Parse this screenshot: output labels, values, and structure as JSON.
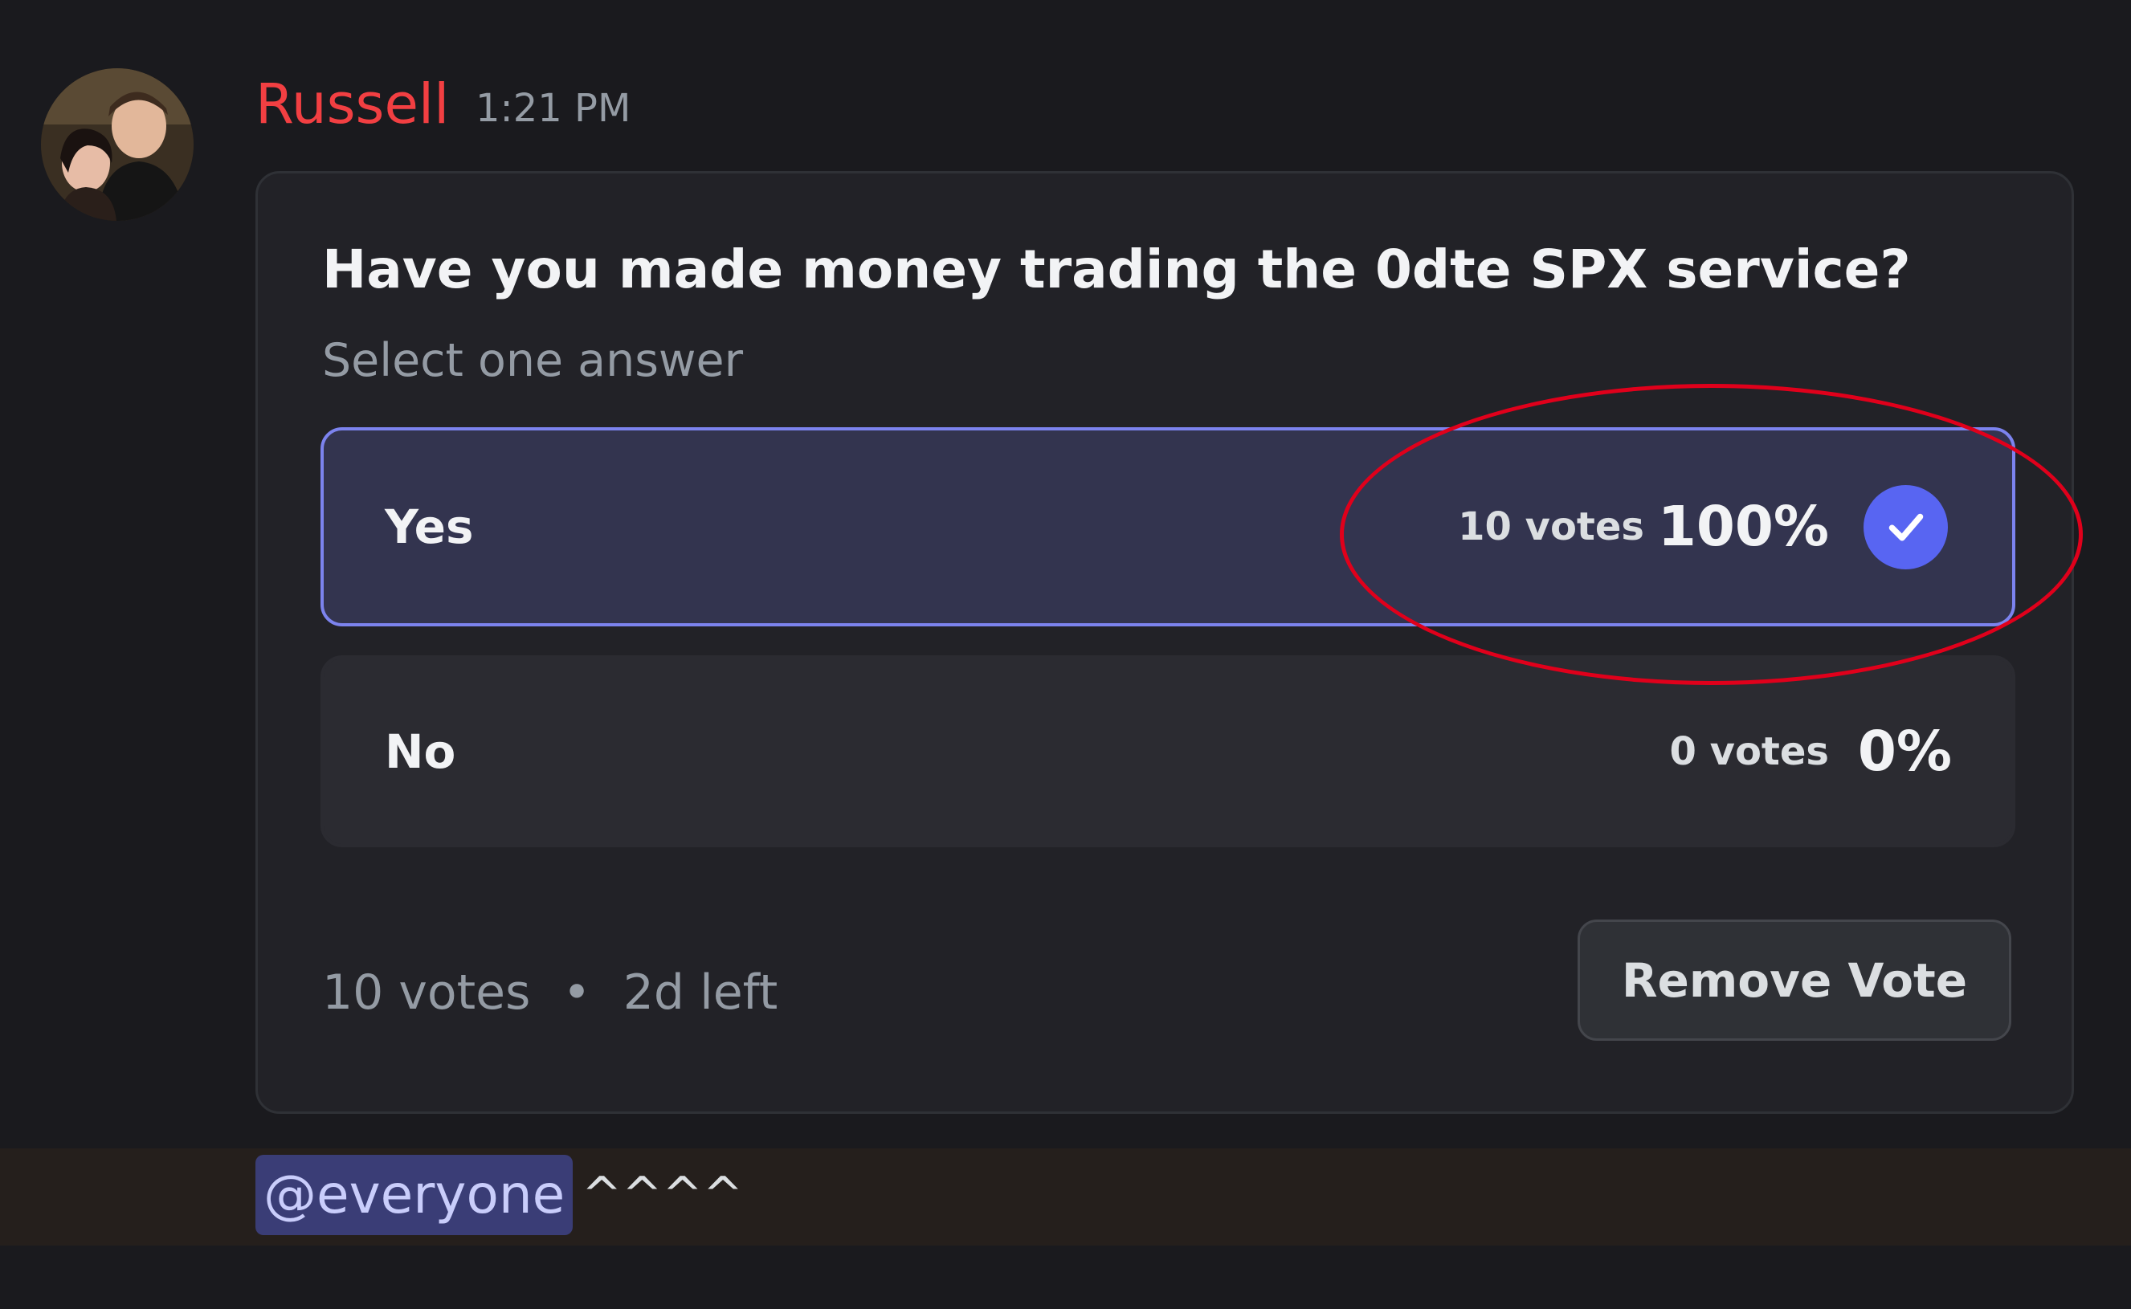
{
  "message": {
    "author": "Russell",
    "author_color": "#f23f42",
    "timestamp": "1:21 PM"
  },
  "poll": {
    "question": "Have you made money trading the 0dte SPX service?",
    "hint": "Select one answer",
    "answers": [
      {
        "label": "Yes",
        "votes": "10 votes",
        "percent": "100%",
        "fraction": 1.0,
        "selected": true,
        "icon": "checkmark-icon"
      },
      {
        "label": "No",
        "votes": "0 votes",
        "percent": "0%",
        "fraction": 0.0,
        "selected": false
      }
    ],
    "footer": {
      "total_votes": "10 votes",
      "separator": "•",
      "time_left": "2d left"
    },
    "remove_vote_label": "Remove Vote",
    "accent_color": "#5865f2"
  },
  "followup": {
    "mention": "@everyone",
    "text": "^^^^"
  },
  "annotation_color": "#e0001b"
}
